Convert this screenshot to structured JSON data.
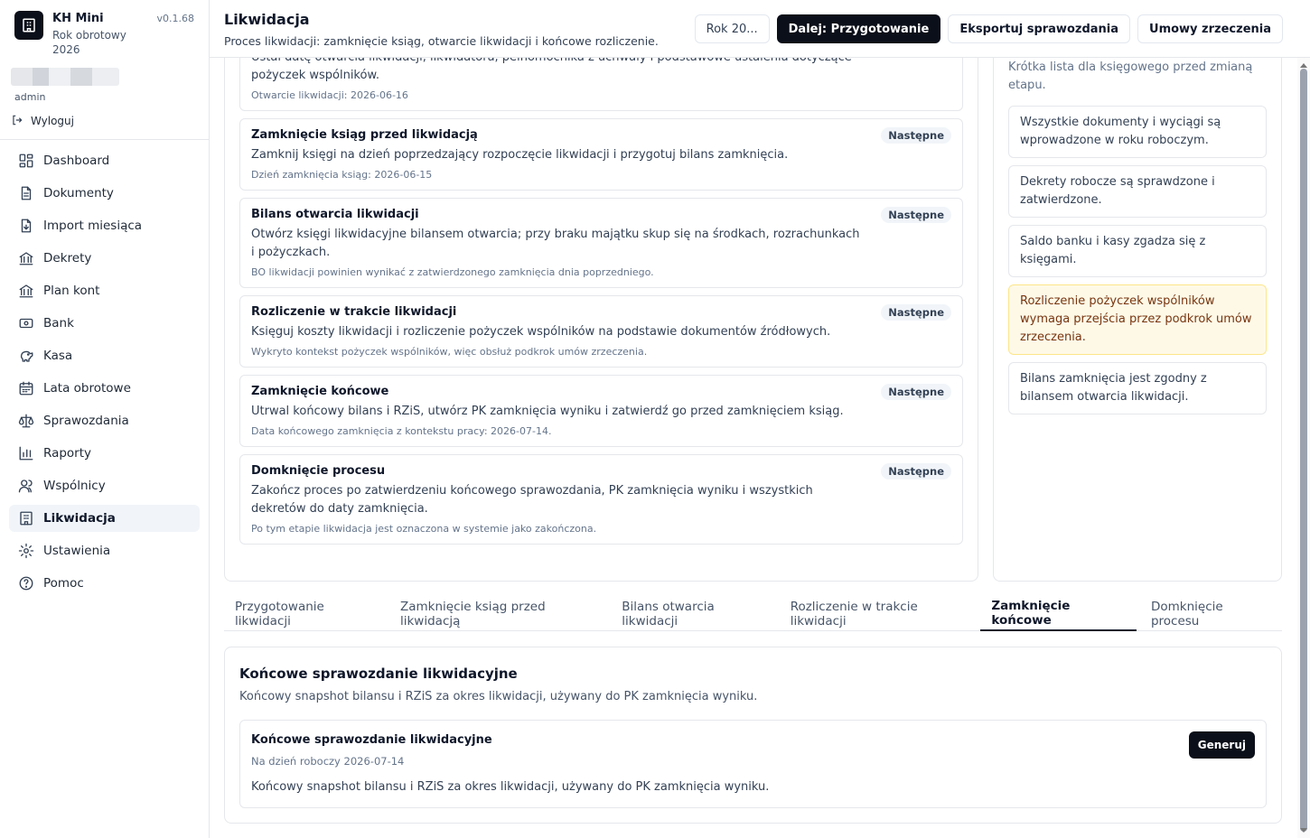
{
  "app": {
    "name": "KH Mini",
    "version": "v0.1.68",
    "fiscal_year": "Rok obrotowy 2026"
  },
  "user": {
    "name": "admin",
    "logout": "Wyloguj"
  },
  "nav": [
    {
      "label": "Dashboard",
      "icon": "dashboard-icon"
    },
    {
      "label": "Dokumenty",
      "icon": "document-icon"
    },
    {
      "label": "Import miesiąca",
      "icon": "import-icon"
    },
    {
      "label": "Dekrety",
      "icon": "bank-building-icon"
    },
    {
      "label": "Plan kont",
      "icon": "bank-building-icon"
    },
    {
      "label": "Bank",
      "icon": "banknote-icon"
    },
    {
      "label": "Kasa",
      "icon": "piggy-bank-icon"
    },
    {
      "label": "Lata obrotowe",
      "icon": "calendar-icon"
    },
    {
      "label": "Sprawozdania",
      "icon": "scale-icon"
    },
    {
      "label": "Raporty",
      "icon": "bar-chart-icon"
    },
    {
      "label": "Wspólnicy",
      "icon": "users-icon"
    },
    {
      "label": "Likwidacja",
      "icon": "building-icon"
    },
    {
      "label": "Ustawienia",
      "icon": "gear-icon"
    },
    {
      "label": "Pomoc",
      "icon": "help-icon"
    }
  ],
  "header": {
    "title": "Likwidacja",
    "subtitle": "Proces likwidacji: zamknięcie ksiąg, otwarcie likwidacji i końcowe rozliczenie.",
    "year_button": "Rok 20...",
    "next_button": "Dalej: Przygotowanie",
    "export_button": "Eksportuj sprawozdania",
    "agreements_button": "Umowy zrzeczenia"
  },
  "steps": [
    {
      "title": "",
      "desc": "Ustal datę otwarcia likwidacji, likwidatora, pełnomocnika z uchwały i podstawowe ustalenia dotyczące pożyczek wspólników.",
      "note": "Otwarcie likwidacji: 2026-06-16",
      "badge": ""
    },
    {
      "title": "Zamknięcie ksiąg przed likwidacją",
      "desc": "Zamknij księgi na dzień poprzedzający rozpoczęcie likwidacji i przygotuj bilans zamknięcia.",
      "note": "Dzień zamknięcia ksiąg: 2026-06-15",
      "badge": "Następne"
    },
    {
      "title": "Bilans otwarcia likwidacji",
      "desc": "Otwórz księgi likwidacyjne bilansem otwarcia; przy braku majątku skup się na środkach, rozrachunkach i pożyczkach.",
      "note": "BO likwidacji powinien wynikać z zatwierdzonego zamknięcia dnia poprzedniego.",
      "badge": "Następne"
    },
    {
      "title": "Rozliczenie w trakcie likwidacji",
      "desc": "Księguj koszty likwidacji i rozliczenie pożyczek wspólników na podstawie dokumentów źródłowych.",
      "note": "Wykryto kontekst pożyczek wspólników, więc obsłuż podkrok umów zrzeczenia.",
      "badge": "Następne"
    },
    {
      "title": "Zamknięcie końcowe",
      "desc": "Utrwal końcowy bilans i RZiS, utwórz PK zamknięcia wyniku i zatwierdź go przed zamknięciem ksiąg.",
      "note": "Data końcowego zamknięcia z kontekstu pracy: 2026-07-14.",
      "badge": "Następne"
    },
    {
      "title": "Domknięcie procesu",
      "desc": "Zakończ proces po zatwierdzeniu końcowego sprawozdania, PK zamknięcia wyniku i wszystkich dekretów do daty zamknięcia.",
      "note": "Po tym etapie likwidacja jest oznaczona w systemie jako zakończona.",
      "badge": "Następne"
    }
  ],
  "checklist": {
    "desc": "Krótka lista dla księgowego przed zmianą etapu.",
    "items": [
      {
        "text": "Wszystkie dokumenty i wyciągi są wprowadzone w roku roboczym.",
        "warn": false
      },
      {
        "text": "Dekrety robocze są sprawdzone i zatwierdzone.",
        "warn": false
      },
      {
        "text": "Saldo banku i kasy zgadza się z księgami.",
        "warn": false
      },
      {
        "text": "Rozliczenie pożyczek wspólników wymaga przejścia przez podkrok umów zrzeczenia.",
        "warn": true
      },
      {
        "text": "Bilans zamknięcia jest zgodny z bilansem otwarcia likwidacji.",
        "warn": false
      }
    ]
  },
  "tabs": [
    {
      "label": "Przygotowanie likwidacji",
      "active": false
    },
    {
      "label": "Zamknięcie ksiąg przed likwidacją",
      "active": false
    },
    {
      "label": "Bilans otwarcia likwidacji",
      "active": false
    },
    {
      "label": "Rozliczenie w trakcie likwidacji",
      "active": false
    },
    {
      "label": "Zamknięcie końcowe",
      "active": true
    },
    {
      "label": "Domknięcie procesu",
      "active": false
    }
  ],
  "final": {
    "title": "Końcowe sprawozdanie likwidacyjne",
    "subtitle": "Końcowy snapshot bilansu i RZiS za okres likwidacji, używany do PK zamknięcia wyniku.",
    "report": {
      "title": "Końcowe sprawozdanie likwidacyjne",
      "date": "Na dzień roboczy 2026-07-14",
      "desc": "Końcowy snapshot bilansu i RZiS za okres likwidacji, używany do PK zamknięcia wyniku.",
      "button": "Generuj"
    }
  }
}
